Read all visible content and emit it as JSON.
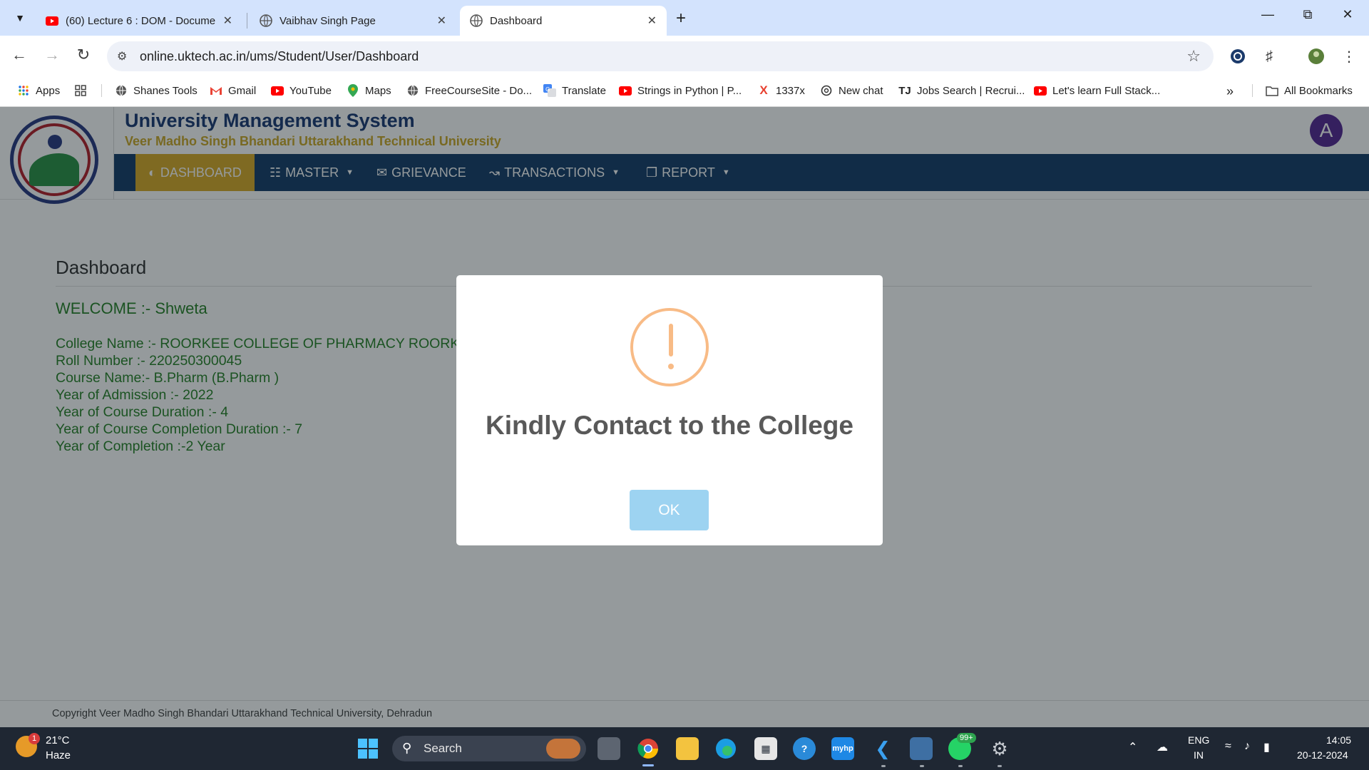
{
  "browser": {
    "tabs": [
      {
        "title": "(60) Lecture 6 : DOM - Docume",
        "icon": "youtube-icon",
        "active": false
      },
      {
        "title": "Vaibhav Singh Page",
        "icon": "globe-icon",
        "active": false
      },
      {
        "title": "Dashboard",
        "icon": "globe-icon",
        "active": true
      }
    ],
    "url": "online.uktech.ac.in/ums/Student/User/Dashboard",
    "bookmarks": [
      {
        "label": "Apps",
        "icon": "apps-grid-icon"
      },
      {
        "label": "",
        "icon": "grid-icon"
      },
      {
        "label": "Shanes Tools",
        "icon": "globe-icon"
      },
      {
        "label": "Gmail",
        "icon": "gmail-icon"
      },
      {
        "label": "YouTube",
        "icon": "youtube-icon"
      },
      {
        "label": "Maps",
        "icon": "maps-icon"
      },
      {
        "label": "FreeCourseSite - Do...",
        "icon": "globe-icon"
      },
      {
        "label": "Translate",
        "icon": "translate-icon"
      },
      {
        "label": "Strings in Python | P...",
        "icon": "youtube-icon"
      },
      {
        "label": "1337x",
        "icon": "x-icon"
      },
      {
        "label": "New chat",
        "icon": "chatgpt-icon"
      },
      {
        "label": "Jobs Search | Recrui...",
        "icon": "tj-icon"
      },
      {
        "label": "Let's learn Full Stack...",
        "icon": "youtube-icon"
      }
    ],
    "all_bookmarks": "All Bookmarks",
    "colors": {
      "tabstrip": "#d3e3fd",
      "omnibox": "#eef1f8"
    }
  },
  "site": {
    "title": "University Management System",
    "subtitle": "Veer Madho Singh Bhandari Uttarakhand Technical University",
    "avatar_letter": "A",
    "nav": [
      {
        "label": "DASHBOARD",
        "icon": "dashboard-icon",
        "active": true,
        "dropdown": false
      },
      {
        "label": "MASTER",
        "icon": "sitemap-icon",
        "active": false,
        "dropdown": true
      },
      {
        "label": "GRIEVANCE",
        "icon": "envelope-icon",
        "active": false,
        "dropdown": false
      },
      {
        "label": "TRANSACTIONS",
        "icon": "chart-line-icon",
        "active": false,
        "dropdown": true
      },
      {
        "label": "REPORT",
        "icon": "copy-icon",
        "active": false,
        "dropdown": true
      }
    ],
    "colors": {
      "title": "#0c2d6b",
      "subtitle": "#c9a21a",
      "navbar": "#06305f",
      "nav_active": "#d5a519",
      "info_text": "#1a7a1a"
    }
  },
  "dashboard": {
    "heading": "Dashboard",
    "welcome": "WELCOME :- Shweta",
    "info_lines": [
      "College Name :- ROORKEE COLLEGE OF PHARMACY ROORKEE",
      "Roll Number :- 220250300045",
      "Course Name:- B.Pharm (B.Pharm )",
      "Year of Admission :- 2022",
      "Year of Course Duration :- 4",
      "Year of Course Completion Duration :- 7",
      "Year of Completion :-2 Year"
    ]
  },
  "footer": {
    "copyright": "Copyright Veer Madho Singh Bhandari Uttarakhand Technical University, Dehradun"
  },
  "modal": {
    "icon": "warning-exclamation-icon",
    "message": "Kindly Contact to the College",
    "button": "OK",
    "colors": {
      "icon": "#f8bb86",
      "button": "#9dd3f1"
    }
  },
  "taskbar": {
    "weather": {
      "temp": "21°C",
      "condition": "Haze",
      "badge": "1"
    },
    "search_label": "Search",
    "whatsapp_badge": "99+",
    "language": {
      "line1": "ENG",
      "line2": "IN"
    },
    "time": "14:05",
    "date": "20-12-2024"
  }
}
